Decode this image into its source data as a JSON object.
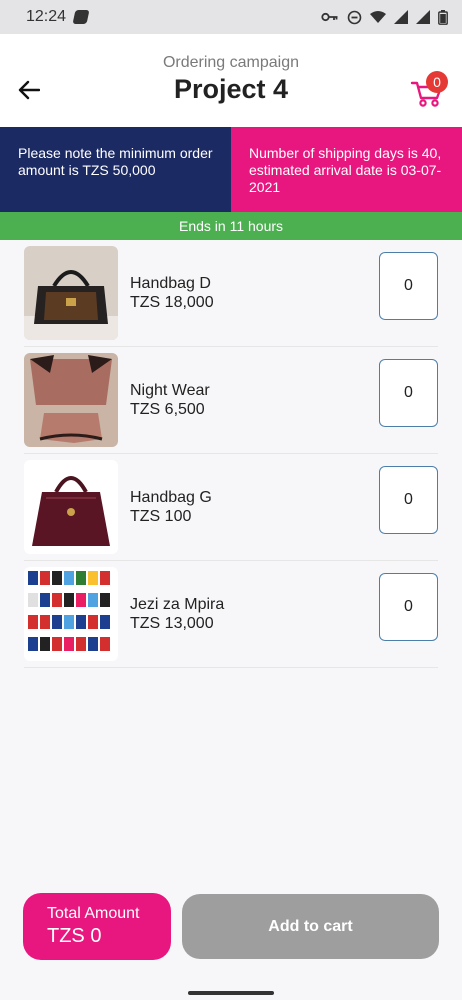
{
  "status_bar": {
    "time": "12:24"
  },
  "header": {
    "subtitle": "Ordering campaign",
    "title": "Project 4",
    "cart_count": "0"
  },
  "banners": {
    "minimum": "Please note the minimum order amount is TZS 50,000",
    "shipping": "Number of shipping days is 40, estimated arrival date is 03-07-2021"
  },
  "countdown": "Ends in 11 hours",
  "products": [
    {
      "name": "Handbag D",
      "price": "TZS 18,000",
      "qty": "0"
    },
    {
      "name": "Night Wear",
      "price": "TZS 6,500",
      "qty": "0"
    },
    {
      "name": "Handbag G",
      "price": "TZS 100",
      "qty": "0"
    },
    {
      "name": "Jezi za Mpira",
      "price": "TZS 13,000",
      "qty": "0"
    }
  ],
  "footer": {
    "total_label": "Total Amount",
    "total_value": "TZS 0",
    "add_to_cart": "Add to cart"
  },
  "colors": {
    "navy": "#1c2a64",
    "pink": "#e8177f",
    "green": "#4caf50",
    "grey_button": "#9e9e9e"
  }
}
